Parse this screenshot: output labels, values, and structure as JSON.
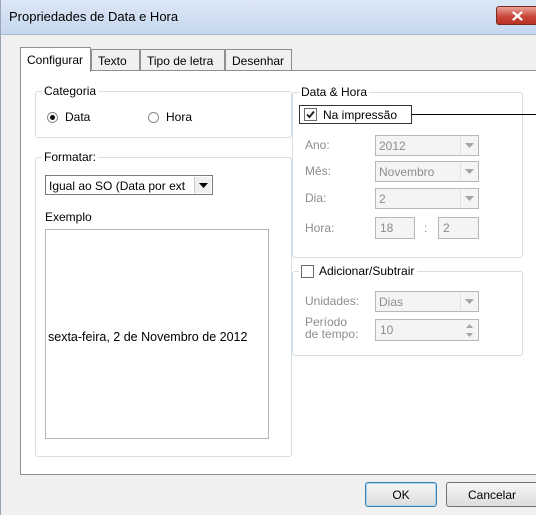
{
  "window": {
    "title": "Propriedades de Data e Hora",
    "close_icon": "close-icon"
  },
  "tabs": [
    {
      "label": "Configurar",
      "active": true
    },
    {
      "label": "Texto",
      "active": false
    },
    {
      "label": "Tipo de letra",
      "active": false
    },
    {
      "label": "Desenhar",
      "active": false
    }
  ],
  "categoria": {
    "label": "Categoria",
    "options": [
      {
        "label": "Data",
        "selected": true
      },
      {
        "label": "Hora",
        "selected": false
      }
    ]
  },
  "formatar": {
    "label": "Formatar:",
    "selected": "Igual ao SO (Data por ext",
    "exemplo_label": "Exemplo",
    "exemplo_text": "sexta-feira, 2 de Novembro de 2012"
  },
  "data_hora": {
    "label": "Data & Hora",
    "na_impressao_label": "Na impressão",
    "na_impressao_checked": true,
    "ano_label": "Ano:",
    "ano_value": "2012",
    "mes_label": "Mês:",
    "mes_value": "Novembro",
    "dia_label": "Dia:",
    "dia_value": "2",
    "hora_label": "Hora:",
    "hora_value": "18",
    "separator": ":",
    "minuto_value": "2"
  },
  "adicionar": {
    "label": "Adicionar/Subtrair",
    "checked": false,
    "unidades_label": "Unidades:",
    "unidades_value": "Dias",
    "periodo_label_1": "Período",
    "periodo_label_2": "de tempo:",
    "periodo_value": "10"
  },
  "buttons": {
    "ok": "OK",
    "cancel": "Cancelar"
  },
  "colors": {
    "close_button": "#c9483b",
    "disabled_text": "#8d8d8d"
  }
}
